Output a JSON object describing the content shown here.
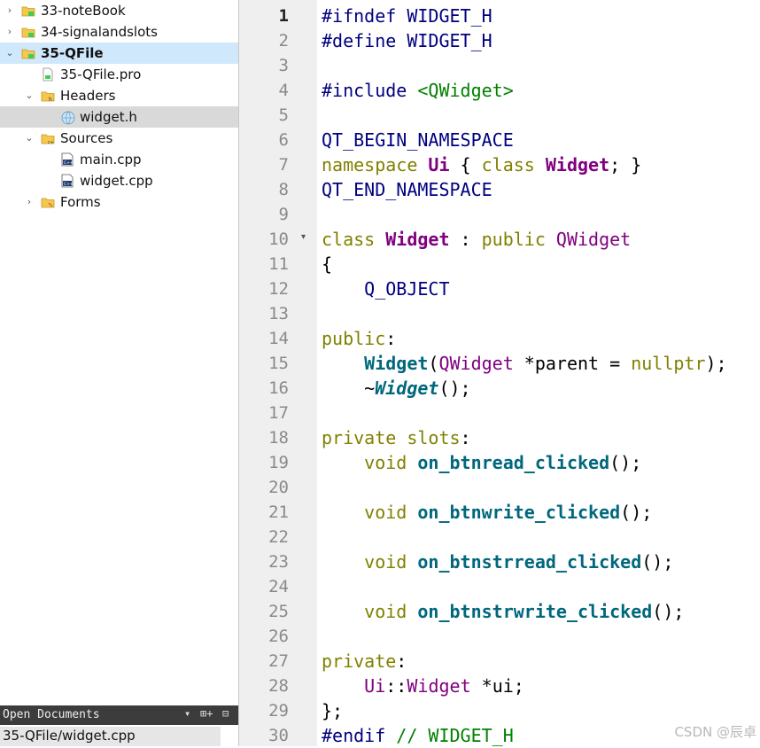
{
  "project_tree": {
    "items": [
      {
        "label": "33-noteBook",
        "level": 0,
        "arrow": "›",
        "icon": "qt-project-folder-icon",
        "bold": false,
        "state": ""
      },
      {
        "label": "34-signalandslots",
        "level": 0,
        "arrow": "›",
        "icon": "qt-project-folder-icon",
        "bold": false,
        "state": ""
      },
      {
        "label": "35-QFile",
        "level": 0,
        "arrow": "⌄",
        "icon": "qt-project-folder-icon",
        "bold": true,
        "state": "sel"
      },
      {
        "label": "35-QFile.pro",
        "level": 1,
        "arrow": "",
        "icon": "pro-file-icon",
        "bold": false,
        "state": ""
      },
      {
        "label": "Headers",
        "level": 1,
        "arrow": "⌄",
        "icon": "headers-folder-icon",
        "bold": false,
        "state": ""
      },
      {
        "label": "widget.h",
        "level": 2,
        "arrow": "",
        "icon": "header-file-icon",
        "bold": false,
        "state": "cur"
      },
      {
        "label": "Sources",
        "level": 1,
        "arrow": "⌄",
        "icon": "sources-folder-icon",
        "bold": false,
        "state": ""
      },
      {
        "label": "main.cpp",
        "level": 2,
        "arrow": "",
        "icon": "cpp-file-icon",
        "bold": false,
        "state": ""
      },
      {
        "label": "widget.cpp",
        "level": 2,
        "arrow": "",
        "icon": "cpp-file-icon",
        "bold": false,
        "state": ""
      },
      {
        "label": "Forms",
        "level": 1,
        "arrow": "›",
        "icon": "forms-folder-icon",
        "bold": false,
        "state": ""
      }
    ]
  },
  "open_documents": {
    "title": "Open Documents",
    "dropdown_glyph": "▾",
    "split_glyph": "⊞+",
    "close_glyph": "⊟",
    "item": "35-QFile/widget.cpp"
  },
  "editor": {
    "current_line": 1,
    "fold_marker_line": 10,
    "fold_glyph": "▾",
    "lines": [
      [
        [
          "pp",
          "#ifndef WIDGET_H"
        ]
      ],
      [
        [
          "pp",
          "#define WIDGET_H"
        ]
      ],
      [],
      [
        [
          "pp",
          "#include "
        ],
        [
          "ppinc",
          "<QWidget>"
        ]
      ],
      [],
      [
        [
          "macro",
          "QT_BEGIN_NAMESPACE"
        ]
      ],
      [
        [
          "kw",
          "namespace "
        ],
        [
          "typeb",
          "Ui"
        ],
        [
          "pl",
          " { "
        ],
        [
          "kw",
          "class "
        ],
        [
          "typeb",
          "Widget"
        ],
        [
          "pl",
          "; }"
        ]
      ],
      [
        [
          "macro",
          "QT_END_NAMESPACE"
        ]
      ],
      [],
      [
        [
          "kw",
          "class "
        ],
        [
          "typeb",
          "Widget"
        ],
        [
          "pl",
          " : "
        ],
        [
          "kw",
          "public "
        ],
        [
          "type",
          "QWidget"
        ]
      ],
      [
        [
          "pl",
          "{"
        ]
      ],
      [
        [
          "pl",
          "    "
        ],
        [
          "macro",
          "Q_OBJECT"
        ]
      ],
      [],
      [
        [
          "kw",
          "public"
        ],
        [
          "pl",
          ":"
        ]
      ],
      [
        [
          "pl",
          "    "
        ],
        [
          "fn",
          "Widget"
        ],
        [
          "pl",
          "("
        ],
        [
          "type",
          "QWidget"
        ],
        [
          "pl",
          " *parent = "
        ],
        [
          "kw",
          "nullptr"
        ],
        [
          "pl",
          ");"
        ]
      ],
      [
        [
          "pl",
          "    ~"
        ],
        [
          "fni",
          "Widget"
        ],
        [
          "pl",
          "();"
        ]
      ],
      [],
      [
        [
          "kw",
          "private slots"
        ],
        [
          "pl",
          ":"
        ]
      ],
      [
        [
          "pl",
          "    "
        ],
        [
          "kw",
          "void "
        ],
        [
          "fn",
          "on_btnread_clicked"
        ],
        [
          "pl",
          "();"
        ]
      ],
      [],
      [
        [
          "pl",
          "    "
        ],
        [
          "kw",
          "void "
        ],
        [
          "fn",
          "on_btnwrite_clicked"
        ],
        [
          "pl",
          "();"
        ]
      ],
      [],
      [
        [
          "pl",
          "    "
        ],
        [
          "kw",
          "void "
        ],
        [
          "fn",
          "on_btnstrread_clicked"
        ],
        [
          "pl",
          "();"
        ]
      ],
      [],
      [
        [
          "pl",
          "    "
        ],
        [
          "kw",
          "void "
        ],
        [
          "fn",
          "on_btnstrwrite_clicked"
        ],
        [
          "pl",
          "();"
        ]
      ],
      [],
      [
        [
          "kw",
          "private"
        ],
        [
          "pl",
          ":"
        ]
      ],
      [
        [
          "pl",
          "    "
        ],
        [
          "type",
          "Ui"
        ],
        [
          "pl",
          "::"
        ],
        [
          "type",
          "Widget"
        ],
        [
          "pl",
          " *ui;"
        ]
      ],
      [
        [
          "pl",
          "};"
        ]
      ],
      [
        [
          "pp",
          "#endif "
        ],
        [
          "cm",
          "// WIDGET_H"
        ]
      ]
    ]
  },
  "watermark": "CSDN @辰卓"
}
